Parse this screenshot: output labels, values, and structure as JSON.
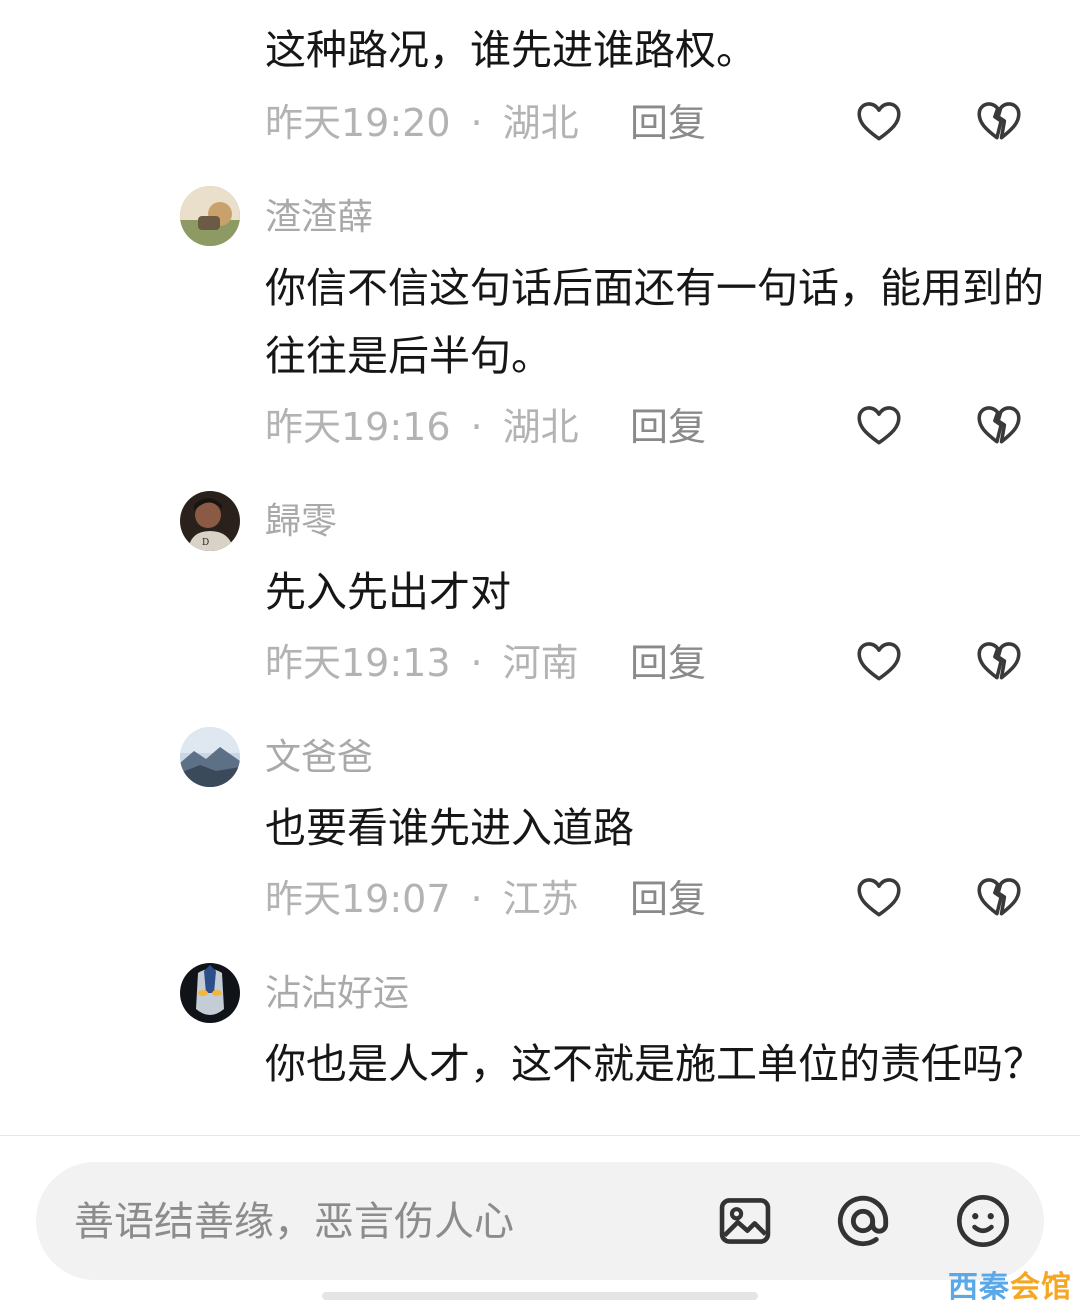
{
  "comments": [
    {
      "username": "",
      "text": "这种路况，谁先进谁路权。",
      "time": "昨天19:20",
      "location": "湖北",
      "reply_label": "回复"
    },
    {
      "username": "渣渣薛",
      "text": "你信不信这句话后面还有一句话，能用到的往往是后半句。",
      "time": "昨天19:16",
      "location": "湖北",
      "reply_label": "回复"
    },
    {
      "username": "歸零",
      "text": "先入先出才对",
      "time": "昨天19:13",
      "location": "河南",
      "reply_label": "回复"
    },
    {
      "username": "文爸爸",
      "text": "也要看谁先进入道路",
      "time": "昨天19:07",
      "location": "江苏",
      "reply_label": "回复"
    },
    {
      "username": "沾沾好运",
      "text": "你也是人才，这不就是施工单位的责任吗？",
      "time": "",
      "location": "",
      "reply_label": ""
    }
  ],
  "meta_separator": "·",
  "icons": {
    "like": "heart-outline-icon",
    "dislike": "broken-heart-icon",
    "image": "image-icon",
    "mention": "at-sign-icon",
    "emoji": "emoji-icon"
  },
  "input": {
    "placeholder": "善语结善缘，恶言伤人心"
  },
  "watermark": {
    "part1": "西秦",
    "part2": "会馆"
  },
  "colors": {
    "text_primary": "#161616",
    "text_secondary": "#a9a9a9",
    "icon": "#3a3a3a",
    "watermark_blue": "#5aa8e8",
    "watermark_orange": "#f5a623"
  }
}
